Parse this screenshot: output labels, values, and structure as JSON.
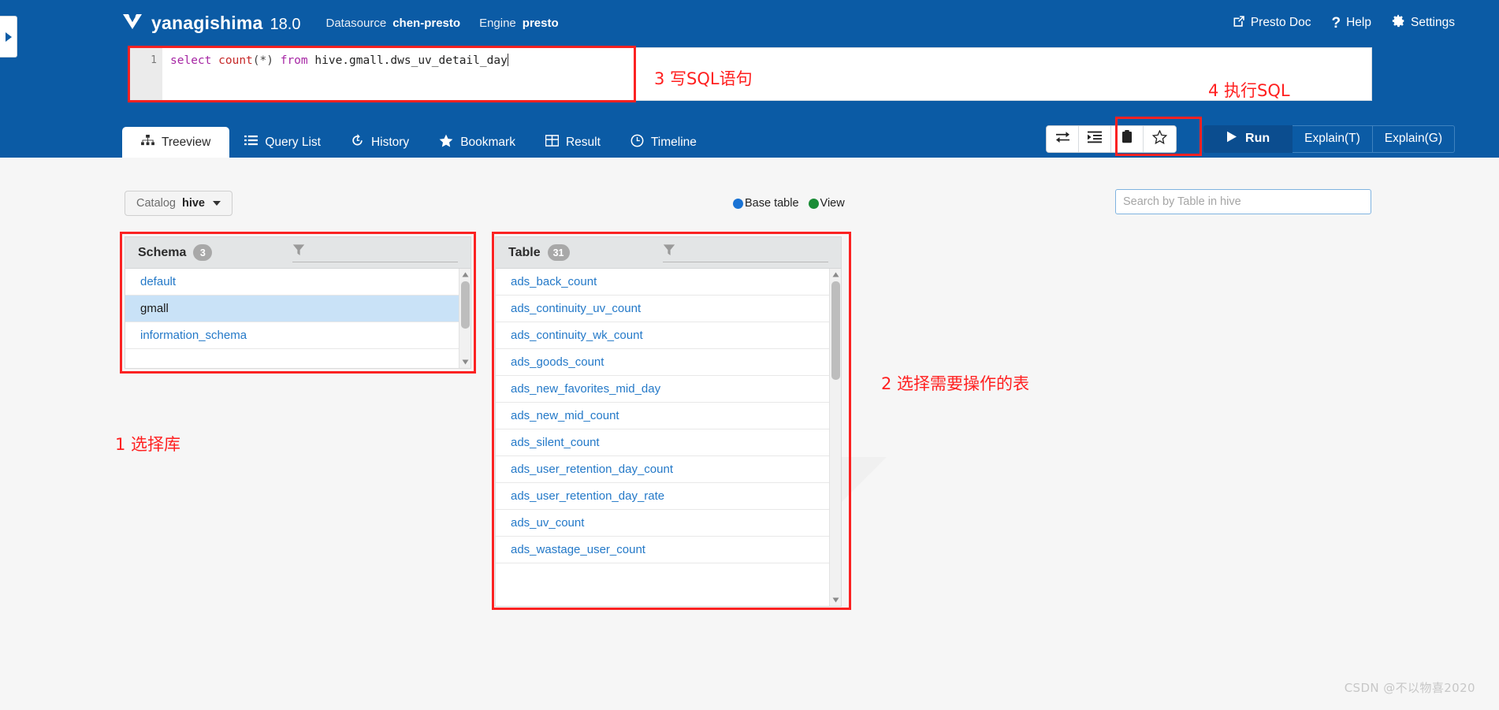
{
  "header": {
    "brand_name": "yanagishima",
    "version": "18.0",
    "datasource_label": "Datasource",
    "datasource_value": "chen-presto",
    "engine_label": "Engine",
    "engine_value": "presto",
    "links": [
      {
        "label": "Presto Doc",
        "icon": "external-link-icon"
      },
      {
        "label": "Help",
        "icon": "question-mark-icon"
      },
      {
        "label": "Settings",
        "icon": "gear-icon"
      }
    ],
    "accent_color": "#0b5ba5"
  },
  "editor": {
    "line_number": "1",
    "sql_keyword1": "select",
    "sql_function": "count",
    "sql_parens": "(*)",
    "sql_keyword2": "from",
    "sql_table": "hive.gmall.dws_uv_detail_day",
    "full_sql": "select count(*) from hive.gmall.dws_uv_detail_day"
  },
  "tabs": [
    {
      "label": "Treeview",
      "icon": "sitemap-icon",
      "active": true
    },
    {
      "label": "Query List",
      "icon": "list-icon",
      "active": false
    },
    {
      "label": "History",
      "icon": "history-icon",
      "active": false
    },
    {
      "label": "Bookmark",
      "icon": "star-icon",
      "active": false
    },
    {
      "label": "Result",
      "icon": "table-icon",
      "active": false
    },
    {
      "label": "Timeline",
      "icon": "clock-icon",
      "active": false
    }
  ],
  "toolbar": {
    "icon_buttons": [
      {
        "name": "swap-icon"
      },
      {
        "name": "indent-icon"
      },
      {
        "name": "clipboard-icon"
      },
      {
        "name": "star-outline-icon"
      }
    ],
    "run_label": "Run",
    "explain_t_label": "Explain(T)",
    "explain_g_label": "Explain(G)"
  },
  "treeview": {
    "catalog_label": "Catalog",
    "catalog_value": "hive",
    "legend": [
      {
        "label": "Base table",
        "color": "#1a73d4"
      },
      {
        "label": "View",
        "color": "#1a8c36"
      }
    ],
    "search_placeholder": "Search by Table in hive",
    "search_value": "",
    "schema_panel": {
      "title": "Schema",
      "count": "3",
      "filter_value": "",
      "items": [
        {
          "label": "default",
          "selected": false
        },
        {
          "label": "gmall",
          "selected": true
        },
        {
          "label": "information_schema",
          "selected": false
        }
      ]
    },
    "table_panel": {
      "title": "Table",
      "count": "31",
      "filter_value": "",
      "items": [
        {
          "label": "ads_back_count"
        },
        {
          "label": "ads_continuity_uv_count"
        },
        {
          "label": "ads_continuity_wk_count"
        },
        {
          "label": "ads_goods_count"
        },
        {
          "label": "ads_new_favorites_mid_day"
        },
        {
          "label": "ads_new_mid_count"
        },
        {
          "label": "ads_silent_count"
        },
        {
          "label": "ads_user_retention_day_count"
        },
        {
          "label": "ads_user_retention_day_rate"
        },
        {
          "label": "ads_uv_count"
        },
        {
          "label": "ads_wastage_user_count"
        }
      ]
    }
  },
  "annotations": [
    {
      "id": "step1",
      "text": "1 选择库"
    },
    {
      "id": "step2",
      "text": "2 选择需要操作的表"
    },
    {
      "id": "step3",
      "text": "3 写SQL语句"
    },
    {
      "id": "step4",
      "text": "4 执行SQL"
    }
  ],
  "watermark": "CSDN @不以物喜2020"
}
